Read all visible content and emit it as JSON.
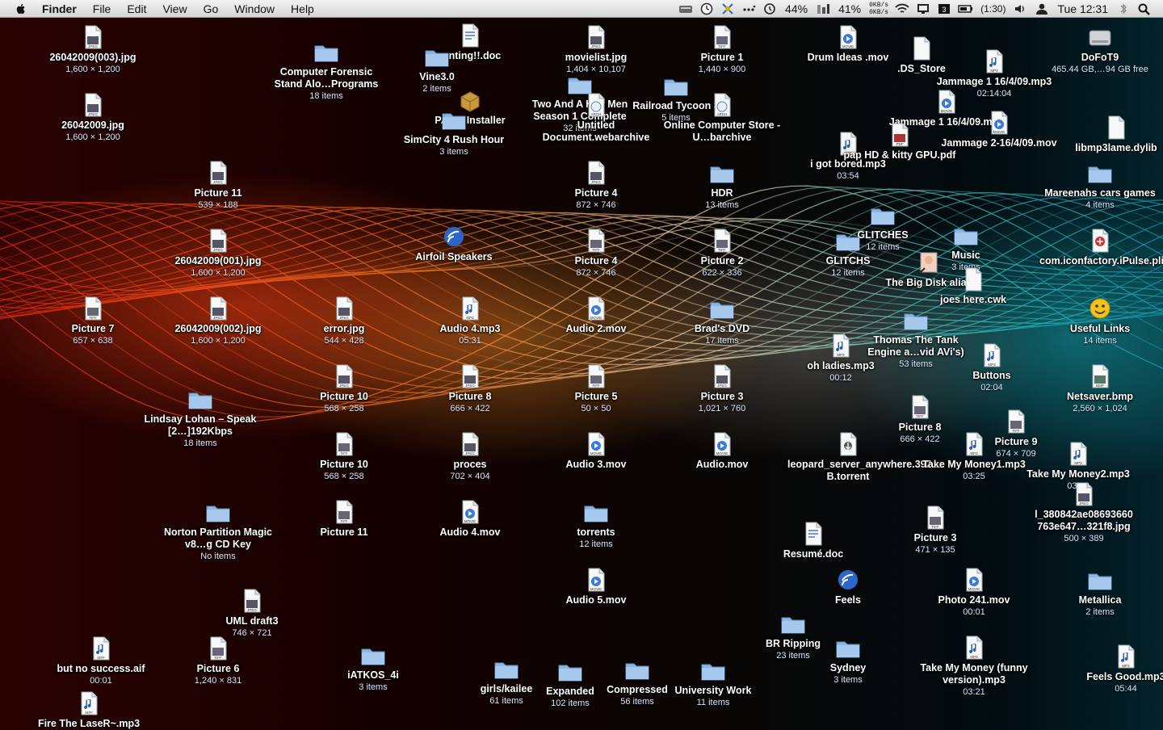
{
  "menubar": {
    "app_name": "Finder",
    "menus": [
      "File",
      "Edit",
      "View",
      "Go",
      "Window",
      "Help"
    ],
    "status": {
      "battery_percent_a": "44%",
      "battery_percent_b": "41%",
      "net_up": "0KB/s",
      "net_down": "0KB/s",
      "battery_time": "(1:30)",
      "clock": "Tue 12:31"
    }
  },
  "desktop": {
    "items": [
      {
        "name": "26042009(003).jpg",
        "sub": "1,600 × 1,200",
        "type": "jpeg"
      },
      {
        "name": "26042009.jpg",
        "sub": "1,600 × 1,200",
        "type": "jpeg"
      },
      {
        "name": "Computer Forensic Stand Alo…Programs",
        "sub": "18 items",
        "type": "folder"
      },
      {
        "name": "renting!!.doc",
        "sub": "",
        "type": "doc"
      },
      {
        "name": "Vine3.0",
        "sub": "2 items",
        "type": "folder"
      },
      {
        "name": "PAK e Installer",
        "sub": "",
        "type": "package"
      },
      {
        "name": "SimCity 4 Rush Hour",
        "sub": "3 items",
        "type": "folder"
      },
      {
        "name": "movielist.jpg",
        "sub": "1,404 × 10,107",
        "type": "jpeg"
      },
      {
        "name": "Two And A Half Men Season 1 Complete",
        "sub": "32 items",
        "type": "folder"
      },
      {
        "name": "Untitled Document.webarchive",
        "sub": "",
        "type": "webarchive"
      },
      {
        "name": "Railroad Tycoon 3",
        "sub": "5 items",
        "type": "folder"
      },
      {
        "name": "Picture 1",
        "sub": "1,440 × 900",
        "type": "tiff"
      },
      {
        "name": "Online Computer Store - U…barchive",
        "sub": "",
        "type": "webarchive"
      },
      {
        "name": "Drum Ideas .mov",
        "sub": "",
        "type": "movie"
      },
      {
        "name": ".DS_Store",
        "sub": "",
        "type": "blank"
      },
      {
        "name": "Jammage 1 16/4/09.mp3",
        "sub": "02:14:04",
        "type": "mp3"
      },
      {
        "name": "Jammage 1 16/4/09.mov",
        "sub": "",
        "type": "movie"
      },
      {
        "name": "Jammage 2-16/4/09.mov",
        "sub": "",
        "type": "movie"
      },
      {
        "name": "DoFoT9",
        "sub": "465.44 GB,…94 GB free",
        "type": "drive"
      },
      {
        "name": "i got bored.mp3",
        "sub": "03:54",
        "type": "mp3"
      },
      {
        "name": "pap HD & kitty GPU.pdf",
        "sub": "",
        "type": "pdf"
      },
      {
        "name": "libmp3lame.dylib",
        "sub": "",
        "type": "blank"
      },
      {
        "name": "Picture 11",
        "sub": "539 × 188",
        "type": "jpeg"
      },
      {
        "name": "Picture 4",
        "sub": "872 × 746",
        "type": "jpeg"
      },
      {
        "name": "HDR",
        "sub": "13 items",
        "type": "folder"
      },
      {
        "name": "Mareenahs cars games",
        "sub": "4 items",
        "type": "folder"
      },
      {
        "name": "26042009(001).jpg",
        "sub": "1,600 × 1,200",
        "type": "jpeg"
      },
      {
        "name": "Airfoil Speakers",
        "sub": "",
        "type": "app"
      },
      {
        "name": "Picture 4",
        "sub": "872 × 746",
        "type": "tiff"
      },
      {
        "name": "Picture 2",
        "sub": "622 × 336",
        "type": "tiff"
      },
      {
        "name": "GLITCHES",
        "sub": "12 items",
        "type": "folder"
      },
      {
        "name": "GLITCHS",
        "sub": "12 items",
        "type": "folder"
      },
      {
        "name": "Music",
        "sub": "3 items",
        "type": "folder"
      },
      {
        "name": "The Big Disk alias",
        "sub": "",
        "type": "alias"
      },
      {
        "name": "joes here.cwk",
        "sub": "",
        "type": "blank"
      },
      {
        "name": "com.iconfactory.iPulse.plist",
        "sub": "",
        "type": "plist"
      },
      {
        "name": "Picture 7",
        "sub": "657 × 638",
        "type": "tiff"
      },
      {
        "name": "26042009(002).jpg",
        "sub": "1,600 × 1,200",
        "type": "jpeg"
      },
      {
        "name": "error.jpg",
        "sub": "544 × 428",
        "type": "jpeg"
      },
      {
        "name": "Audio 4.mp3",
        "sub": "05:31",
        "type": "mp3"
      },
      {
        "name": "Audio 2.mov",
        "sub": "",
        "type": "movie"
      },
      {
        "name": "Brad's DVD",
        "sub": "17 items",
        "type": "folder"
      },
      {
        "name": "Thomas The Tank Engine a…vid AVi's)",
        "sub": "53 items",
        "type": "folder"
      },
      {
        "name": "Useful Links",
        "sub": "14 items",
        "type": "smiley"
      },
      {
        "name": "oh ladies.mp3",
        "sub": "00:12",
        "type": "mp3"
      },
      {
        "name": "Buttons",
        "sub": "02:04",
        "type": "mp3"
      },
      {
        "name": "Picture 10",
        "sub": "568 × 258",
        "type": "jpeg"
      },
      {
        "name": "Picture 8",
        "sub": "666 × 422",
        "type": "jpeg"
      },
      {
        "name": "Picture 5",
        "sub": "50 × 50",
        "type": "tiff"
      },
      {
        "name": "Picture 3",
        "sub": "1,021 × 760",
        "type": "jpeg"
      },
      {
        "name": "Netsaver.bmp",
        "sub": "2,560 × 1,024",
        "type": "bmp"
      },
      {
        "name": "Lindsay Lohan – Speak [2…]192Kbps",
        "sub": "18 items",
        "type": "folder"
      },
      {
        "name": "Picture 8",
        "sub": "666 × 422",
        "type": "tiff"
      },
      {
        "name": "Picture 9",
        "sub": "674 × 709",
        "type": "tiff"
      },
      {
        "name": "Picture 10",
        "sub": "568 × 258",
        "type": "tiff"
      },
      {
        "name": "proces",
        "sub": "702 × 404",
        "type": "jpeg"
      },
      {
        "name": "Audio 3.mov",
        "sub": "",
        "type": "movie"
      },
      {
        "name": "Audio.mov",
        "sub": "",
        "type": "movie"
      },
      {
        "name": "leopard_server_anywhere.392…B.torrent",
        "sub": "",
        "type": "torrent"
      },
      {
        "name": "Take My Money1.mp3",
        "sub": "03:25",
        "type": "mp3"
      },
      {
        "name": "Take My Money2.mp3",
        "sub": "03:26",
        "type": "mp3"
      },
      {
        "name": "l_380842ae08693660 763e647…321f8.jpg",
        "sub": "500 × 389",
        "type": "jpeg"
      },
      {
        "name": "Norton Partition Magic v8…g CD Key",
        "sub": "No items",
        "type": "folder"
      },
      {
        "name": "Picture 11",
        "sub": "",
        "type": "tiff"
      },
      {
        "name": "Audio 4.mov",
        "sub": "",
        "type": "movie"
      },
      {
        "name": "torrents",
        "sub": "12 items",
        "type": "folder"
      },
      {
        "name": "Picture 3",
        "sub": "471 × 135",
        "type": "tiff"
      },
      {
        "name": "Resumé.doc",
        "sub": "",
        "type": "doc"
      },
      {
        "name": "Audio 5.mov",
        "sub": "",
        "type": "movie"
      },
      {
        "name": "Feels",
        "sub": "",
        "type": "app"
      },
      {
        "name": "Photo 241.mov",
        "sub": "00:01",
        "type": "movie"
      },
      {
        "name": "Metallica",
        "sub": "2 items",
        "type": "folder"
      },
      {
        "name": "UML draft3",
        "sub": "746 × 721",
        "type": "jpeg"
      },
      {
        "name": "BR Ripping",
        "sub": "23 items",
        "type": "folder"
      },
      {
        "name": "but no success.aif",
        "sub": "00:01",
        "type": "aif"
      },
      {
        "name": "Picture 6",
        "sub": "1,240 × 831",
        "type": "tiff"
      },
      {
        "name": "iATKOS_4i",
        "sub": "3 items",
        "type": "folder"
      },
      {
        "name": "girls/kailee",
        "sub": "61 items",
        "type": "folder"
      },
      {
        "name": "Expanded",
        "sub": "102 items",
        "type": "folder"
      },
      {
        "name": "Compressed",
        "sub": "56 items",
        "type": "folder"
      },
      {
        "name": "University Work",
        "sub": "11 items",
        "type": "folder"
      },
      {
        "name": "Sydney",
        "sub": "3 items",
        "type": "folder"
      },
      {
        "name": "Take My Money (funny version).mp3",
        "sub": "03:21",
        "type": "mp3"
      },
      {
        "name": "Feels Good.mp3",
        "sub": "05:44",
        "type": "mp3"
      },
      {
        "name": "Fire The LaseR~.mp3",
        "sub": "",
        "type": "aif"
      }
    ]
  }
}
